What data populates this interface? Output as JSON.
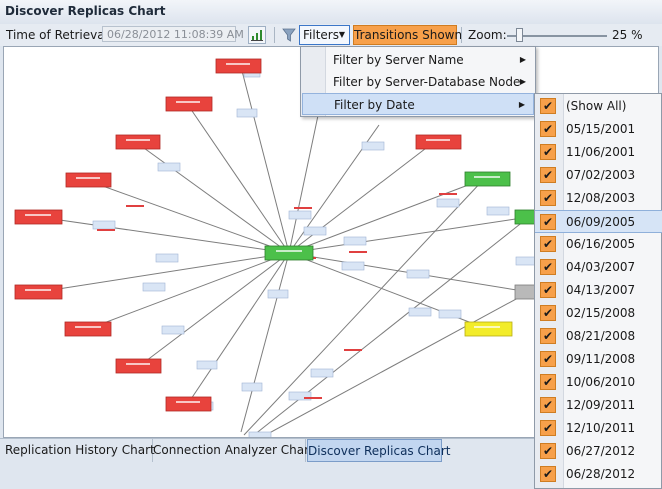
{
  "window": {
    "title": "Discover Replicas Chart"
  },
  "toolbar": {
    "time_label": "Time of Retrieval:",
    "time_value": "06/28/2012 11:08:39 AM",
    "chart_icon": "bar-chart-icon",
    "funnel_icon": "funnel-icon",
    "filters_label": "Filters",
    "transitions_label": "Transitions Shown",
    "zoom_label": "Zoom:",
    "zoom_value": "25 %",
    "zoom_fraction": 0.25
  },
  "filter_menu": {
    "items": [
      {
        "label": "Filter by Server Name",
        "highlighted": false
      },
      {
        "label": "Filter by Server-Database Node",
        "highlighted": false
      },
      {
        "label": "Filter by Date",
        "highlighted": true
      }
    ]
  },
  "date_menu": {
    "items": [
      {
        "label": "(Show All)",
        "checked": true
      },
      {
        "label": "05/15/2001",
        "checked": true
      },
      {
        "label": "11/06/2001",
        "checked": true
      },
      {
        "label": "07/02/2003",
        "checked": true
      },
      {
        "label": "12/08/2003",
        "checked": true
      },
      {
        "label": "06/09/2005",
        "checked": true,
        "highlighted": true
      },
      {
        "label": "06/16/2005",
        "checked": true
      },
      {
        "label": "04/03/2007",
        "checked": true
      },
      {
        "label": "04/13/2007",
        "checked": true
      },
      {
        "label": "02/15/2008",
        "checked": true
      },
      {
        "label": "08/21/2008",
        "checked": true
      },
      {
        "label": "09/11/2008",
        "checked": true
      },
      {
        "label": "10/06/2010",
        "checked": true
      },
      {
        "label": "12/09/2011",
        "checked": true
      },
      {
        "label": "12/10/2011",
        "checked": true
      },
      {
        "label": "06/27/2012",
        "checked": true
      },
      {
        "label": "06/28/2012",
        "checked": true
      }
    ]
  },
  "tabs": [
    {
      "label": "Replication History Chart",
      "active": false
    },
    {
      "label": "Connection Analyzer Chart",
      "active": false
    },
    {
      "label": "Discover Replicas Chart",
      "active": true
    }
  ],
  "colors": {
    "accent": "#f7a04a",
    "node_red": "#e8433d",
    "node_green": "#4cc04a",
    "node_yellow": "#f2ec2a",
    "node_gray": "#b9b9b9",
    "edge_label": "#d9e5f5"
  }
}
